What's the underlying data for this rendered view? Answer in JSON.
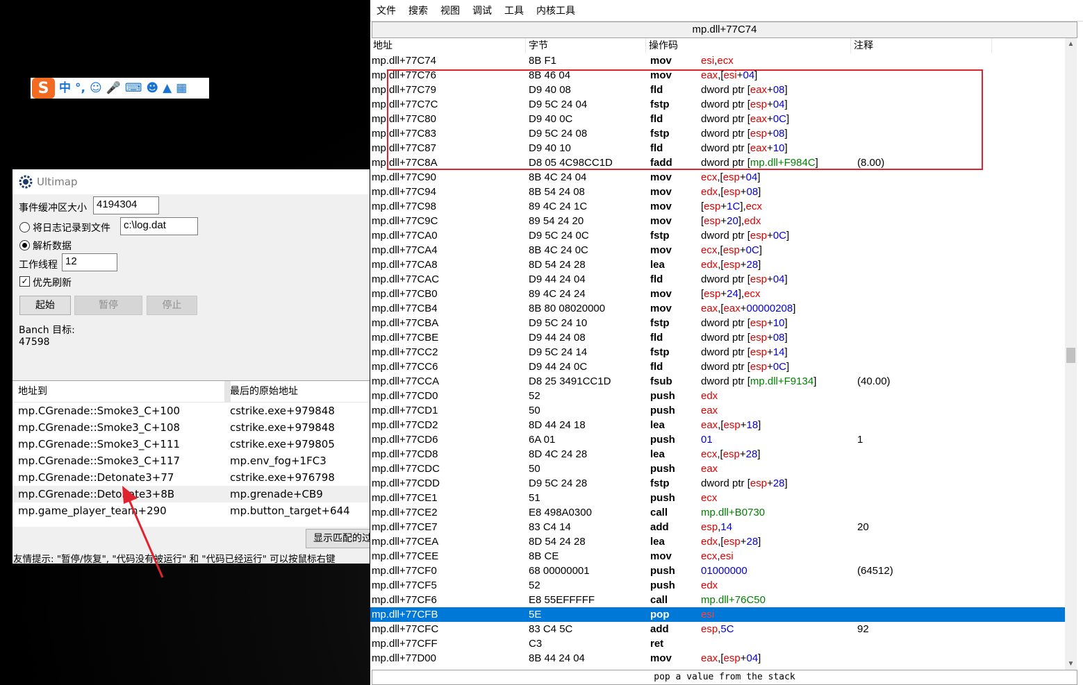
{
  "ime": {
    "logo": "S",
    "items": [
      "中",
      "°,"
    ]
  },
  "ultimap": {
    "title": "Ultimap",
    "buffer_label": "事件缓冲区大小",
    "buffer_value": "4194304",
    "log_label": "将日志记录到文件",
    "log_path": "c:\\log.dat",
    "parse_label": "解析数据",
    "threads_label": "工作线程",
    "threads_value": "12",
    "refresh_label": "优先刷新",
    "btn_start": "起始",
    "btn_pause": "暂停",
    "btn_stop": "停止",
    "branch_label": "Banch 目标:",
    "branch_count": "47598",
    "list": {
      "col1": "地址到",
      "col2": "最后的原始地址",
      "rows": [
        [
          "mp.CGrenade::Smoke3_C+100",
          "cstrike.exe+979848"
        ],
        [
          "mp.CGrenade::Smoke3_C+108",
          "cstrike.exe+979848"
        ],
        [
          "mp.CGrenade::Smoke3_C+111",
          "cstrike.exe+979805"
        ],
        [
          "mp.CGrenade::Smoke3_C+117",
          "mp.env_fog+1FC3"
        ],
        [
          "mp.CGrenade::Detonate3+77",
          "cstrike.exe+976798"
        ],
        [
          "mp.CGrenade::Detonate3+8B",
          "mp.grenade+CB9"
        ],
        [
          "mp.game_player_team+290",
          "mp.button_target+644"
        ]
      ]
    },
    "show_matching_btn": "显示匹配的过",
    "tip": "友情提示: \"暂停/恢复\", \"代码没有被运行\" 和 \"代码已经运行\" 可以按鼠标右键"
  },
  "memview": {
    "menu": [
      "文件",
      "搜索",
      "视图",
      "调试",
      "工具",
      "内核工具"
    ],
    "address": "mp.dll+77C74",
    "headers": [
      "地址",
      "字节",
      "操作码",
      "注释"
    ],
    "status": "pop a value from the stack",
    "rows": [
      {
        "addr": "mp.dll+77C74",
        "bytes": "8B F1",
        "mn": "mov",
        "op": [
          [
            "r",
            "esi"
          ],
          [
            "p",
            ","
          ],
          [
            "r",
            "ecx"
          ]
        ],
        "note": ""
      },
      {
        "addr": "mp.dll+77C76",
        "bytes": "8B 46 04",
        "mn": "mov",
        "op": [
          [
            "r",
            "eax"
          ],
          [
            "p",
            ",["
          ],
          [
            "r",
            "esi"
          ],
          [
            "p",
            "+"
          ],
          [
            "n",
            "04"
          ],
          [
            "p",
            "]"
          ]
        ],
        "note": ""
      },
      {
        "addr": "mp.dll+77C79",
        "bytes": "D9 40 08",
        "mn": "fld",
        "op": [
          [
            "p",
            "dword ptr ["
          ],
          [
            "r",
            "eax"
          ],
          [
            "p",
            "+"
          ],
          [
            "n",
            "08"
          ],
          [
            "p",
            "]"
          ]
        ],
        "note": ""
      },
      {
        "addr": "mp.dll+77C7C",
        "bytes": "D9 5C 24 04",
        "mn": "fstp",
        "op": [
          [
            "p",
            "dword ptr ["
          ],
          [
            "r",
            "esp"
          ],
          [
            "p",
            "+"
          ],
          [
            "n",
            "04"
          ],
          [
            "p",
            "]"
          ]
        ],
        "note": ""
      },
      {
        "addr": "mp.dll+77C80",
        "bytes": "D9 40 0C",
        "mn": "fld",
        "op": [
          [
            "p",
            "dword ptr ["
          ],
          [
            "r",
            "eax"
          ],
          [
            "p",
            "+"
          ],
          [
            "n",
            "0C"
          ],
          [
            "p",
            "]"
          ]
        ],
        "note": ""
      },
      {
        "addr": "mp.dll+77C83",
        "bytes": "D9 5C 24 08",
        "mn": "fstp",
        "op": [
          [
            "p",
            "dword ptr ["
          ],
          [
            "r",
            "esp"
          ],
          [
            "p",
            "+"
          ],
          [
            "n",
            "08"
          ],
          [
            "p",
            "]"
          ]
        ],
        "note": ""
      },
      {
        "addr": "mp.dll+77C87",
        "bytes": "D9 40 10",
        "mn": "fld",
        "op": [
          [
            "p",
            "dword ptr ["
          ],
          [
            "r",
            "eax"
          ],
          [
            "p",
            "+"
          ],
          [
            "n",
            "10"
          ],
          [
            "p",
            "]"
          ]
        ],
        "note": ""
      },
      {
        "addr": "mp.dll+77C8A",
        "bytes": "D8 05 4C98CC1D",
        "mn": "fadd",
        "op": [
          [
            "p",
            "dword ptr ["
          ],
          [
            "s",
            "mp.dll+F984C"
          ],
          [
            "p",
            "]"
          ]
        ],
        "note": "(8.00)"
      },
      {
        "addr": "mp.dll+77C90",
        "bytes": "8B 4C 24 04",
        "mn": "mov",
        "op": [
          [
            "r",
            "ecx"
          ],
          [
            "p",
            ",["
          ],
          [
            "r",
            "esp"
          ],
          [
            "p",
            "+"
          ],
          [
            "n",
            "04"
          ],
          [
            "p",
            "]"
          ]
        ],
        "note": ""
      },
      {
        "addr": "mp.dll+77C94",
        "bytes": "8B 54 24 08",
        "mn": "mov",
        "op": [
          [
            "r",
            "edx"
          ],
          [
            "p",
            ",["
          ],
          [
            "r",
            "esp"
          ],
          [
            "p",
            "+"
          ],
          [
            "n",
            "08"
          ],
          [
            "p",
            "]"
          ]
        ],
        "note": ""
      },
      {
        "addr": "mp.dll+77C98",
        "bytes": "89 4C 24 1C",
        "mn": "mov",
        "op": [
          [
            "p",
            "["
          ],
          [
            "r",
            "esp"
          ],
          [
            "p",
            "+"
          ],
          [
            "n",
            "1C"
          ],
          [
            "p",
            "],"
          ],
          [
            "r",
            "ecx"
          ]
        ],
        "note": ""
      },
      {
        "addr": "mp.dll+77C9C",
        "bytes": "89 54 24 20",
        "mn": "mov",
        "op": [
          [
            "p",
            "["
          ],
          [
            "r",
            "esp"
          ],
          [
            "p",
            "+"
          ],
          [
            "n",
            "20"
          ],
          [
            "p",
            "],"
          ],
          [
            "r",
            "edx"
          ]
        ],
        "note": ""
      },
      {
        "addr": "mp.dll+77CA0",
        "bytes": "D9 5C 24 0C",
        "mn": "fstp",
        "op": [
          [
            "p",
            "dword ptr ["
          ],
          [
            "r",
            "esp"
          ],
          [
            "p",
            "+"
          ],
          [
            "n",
            "0C"
          ],
          [
            "p",
            "]"
          ]
        ],
        "note": ""
      },
      {
        "addr": "mp.dll+77CA4",
        "bytes": "8B 4C 24 0C",
        "mn": "mov",
        "op": [
          [
            "r",
            "ecx"
          ],
          [
            "p",
            ",["
          ],
          [
            "r",
            "esp"
          ],
          [
            "p",
            "+"
          ],
          [
            "n",
            "0C"
          ],
          [
            "p",
            "]"
          ]
        ],
        "note": ""
      },
      {
        "addr": "mp.dll+77CA8",
        "bytes": "8D 54 24 28",
        "mn": "lea",
        "op": [
          [
            "r",
            "edx"
          ],
          [
            "p",
            ",["
          ],
          [
            "r",
            "esp"
          ],
          [
            "p",
            "+"
          ],
          [
            "n",
            "28"
          ],
          [
            "p",
            "]"
          ]
        ],
        "note": ""
      },
      {
        "addr": "mp.dll+77CAC",
        "bytes": "D9 44 24 04",
        "mn": "fld",
        "op": [
          [
            "p",
            "dword ptr ["
          ],
          [
            "r",
            "esp"
          ],
          [
            "p",
            "+"
          ],
          [
            "n",
            "04"
          ],
          [
            "p",
            "]"
          ]
        ],
        "note": ""
      },
      {
        "addr": "mp.dll+77CB0",
        "bytes": "89 4C 24 24",
        "mn": "mov",
        "op": [
          [
            "p",
            "["
          ],
          [
            "r",
            "esp"
          ],
          [
            "p",
            "+"
          ],
          [
            "n",
            "24"
          ],
          [
            "p",
            "],"
          ],
          [
            "r",
            "ecx"
          ]
        ],
        "note": ""
      },
      {
        "addr": "mp.dll+77CB4",
        "bytes": "8B 80 08020000",
        "mn": "mov",
        "op": [
          [
            "r",
            "eax"
          ],
          [
            "p",
            ",["
          ],
          [
            "r",
            "eax"
          ],
          [
            "p",
            "+"
          ],
          [
            "n",
            "00000208"
          ],
          [
            "p",
            "]"
          ]
        ],
        "note": ""
      },
      {
        "addr": "mp.dll+77CBA",
        "bytes": "D9 5C 24 10",
        "mn": "fstp",
        "op": [
          [
            "p",
            "dword ptr ["
          ],
          [
            "r",
            "esp"
          ],
          [
            "p",
            "+"
          ],
          [
            "n",
            "10"
          ],
          [
            "p",
            "]"
          ]
        ],
        "note": ""
      },
      {
        "addr": "mp.dll+77CBE",
        "bytes": "D9 44 24 08",
        "mn": "fld",
        "op": [
          [
            "p",
            "dword ptr ["
          ],
          [
            "r",
            "esp"
          ],
          [
            "p",
            "+"
          ],
          [
            "n",
            "08"
          ],
          [
            "p",
            "]"
          ]
        ],
        "note": ""
      },
      {
        "addr": "mp.dll+77CC2",
        "bytes": "D9 5C 24 14",
        "mn": "fstp",
        "op": [
          [
            "p",
            "dword ptr ["
          ],
          [
            "r",
            "esp"
          ],
          [
            "p",
            "+"
          ],
          [
            "n",
            "14"
          ],
          [
            "p",
            "]"
          ]
        ],
        "note": ""
      },
      {
        "addr": "mp.dll+77CC6",
        "bytes": "D9 44 24 0C",
        "mn": "fld",
        "op": [
          [
            "p",
            "dword ptr ["
          ],
          [
            "r",
            "esp"
          ],
          [
            "p",
            "+"
          ],
          [
            "n",
            "0C"
          ],
          [
            "p",
            "]"
          ]
        ],
        "note": ""
      },
      {
        "addr": "mp.dll+77CCA",
        "bytes": "D8 25 3491CC1D",
        "mn": "fsub",
        "op": [
          [
            "p",
            "dword ptr ["
          ],
          [
            "s",
            "mp.dll+F9134"
          ],
          [
            "p",
            "]"
          ]
        ],
        "note": "(40.00)"
      },
      {
        "addr": "mp.dll+77CD0",
        "bytes": "52",
        "mn": "push",
        "op": [
          [
            "r",
            "edx"
          ]
        ],
        "note": ""
      },
      {
        "addr": "mp.dll+77CD1",
        "bytes": "50",
        "mn": "push",
        "op": [
          [
            "r",
            "eax"
          ]
        ],
        "note": ""
      },
      {
        "addr": "mp.dll+77CD2",
        "bytes": "8D 44 24 18",
        "mn": "lea",
        "op": [
          [
            "r",
            "eax"
          ],
          [
            "p",
            ",["
          ],
          [
            "r",
            "esp"
          ],
          [
            "p",
            "+"
          ],
          [
            "n",
            "18"
          ],
          [
            "p",
            "]"
          ]
        ],
        "note": ""
      },
      {
        "addr": "mp.dll+77CD6",
        "bytes": "6A 01",
        "mn": "push",
        "op": [
          [
            "n",
            "01"
          ]
        ],
        "note": "1"
      },
      {
        "addr": "mp.dll+77CD8",
        "bytes": "8D 4C 24 28",
        "mn": "lea",
        "op": [
          [
            "r",
            "ecx"
          ],
          [
            "p",
            ",["
          ],
          [
            "r",
            "esp"
          ],
          [
            "p",
            "+"
          ],
          [
            "n",
            "28"
          ],
          [
            "p",
            "]"
          ]
        ],
        "note": ""
      },
      {
        "addr": "mp.dll+77CDC",
        "bytes": "50",
        "mn": "push",
        "op": [
          [
            "r",
            "eax"
          ]
        ],
        "note": ""
      },
      {
        "addr": "mp.dll+77CDD",
        "bytes": "D9 5C 24 28",
        "mn": "fstp",
        "op": [
          [
            "p",
            "dword ptr ["
          ],
          [
            "r",
            "esp"
          ],
          [
            "p",
            "+"
          ],
          [
            "n",
            "28"
          ],
          [
            "p",
            "]"
          ]
        ],
        "note": ""
      },
      {
        "addr": "mp.dll+77CE1",
        "bytes": "51",
        "mn": "push",
        "op": [
          [
            "r",
            "ecx"
          ]
        ],
        "note": ""
      },
      {
        "addr": "mp.dll+77CE2",
        "bytes": "E8 498A0300",
        "mn": "call",
        "op": [
          [
            "s",
            "mp.dll+B0730"
          ]
        ],
        "note": ""
      },
      {
        "addr": "mp.dll+77CE7",
        "bytes": "83 C4 14",
        "mn": "add",
        "op": [
          [
            "r",
            "esp"
          ],
          [
            "p",
            ","
          ],
          [
            "n",
            "14"
          ]
        ],
        "note": "20"
      },
      {
        "addr": "mp.dll+77CEA",
        "bytes": "8D 54 24 28",
        "mn": "lea",
        "op": [
          [
            "r",
            "edx"
          ],
          [
            "p",
            ",["
          ],
          [
            "r",
            "esp"
          ],
          [
            "p",
            "+"
          ],
          [
            "n",
            "28"
          ],
          [
            "p",
            "]"
          ]
        ],
        "note": ""
      },
      {
        "addr": "mp.dll+77CEE",
        "bytes": "8B CE",
        "mn": "mov",
        "op": [
          [
            "r",
            "ecx"
          ],
          [
            "p",
            ","
          ],
          [
            "r",
            "esi"
          ]
        ],
        "note": ""
      },
      {
        "addr": "mp.dll+77CF0",
        "bytes": "68 00000001",
        "mn": "push",
        "op": [
          [
            "n",
            "01000000"
          ]
        ],
        "note": "(64512)"
      },
      {
        "addr": "mp.dll+77CF5",
        "bytes": "52",
        "mn": "push",
        "op": [
          [
            "r",
            "edx"
          ]
        ],
        "note": ""
      },
      {
        "addr": "mp.dll+77CF6",
        "bytes": "E8 55EFFFFF",
        "mn": "call",
        "op": [
          [
            "s",
            "mp.dll+76C50"
          ]
        ],
        "note": ""
      },
      {
        "addr": "mp.dll+77CFB",
        "bytes": "5E",
        "mn": "pop",
        "op": [
          [
            "r",
            "esi"
          ]
        ],
        "note": "",
        "selected": true
      },
      {
        "addr": "mp.dll+77CFC",
        "bytes": "83 C4 5C",
        "mn": "add",
        "op": [
          [
            "r",
            "esp"
          ],
          [
            "p",
            ","
          ],
          [
            "n",
            "5C"
          ]
        ],
        "note": "92"
      },
      {
        "addr": "mp.dll+77CFF",
        "bytes": "C3",
        "mn": "ret",
        "op": [],
        "note": ""
      },
      {
        "addr": "mp.dll+77D00",
        "bytes": "8B 44 24 04",
        "mn": "mov",
        "op": [
          [
            "r",
            "eax"
          ],
          [
            "p",
            ",["
          ],
          [
            "r",
            "esp"
          ],
          [
            "p",
            "+"
          ],
          [
            "n",
            "04"
          ],
          [
            "p",
            "]"
          ]
        ],
        "note": ""
      }
    ]
  },
  "colors": {
    "register": "#e00000",
    "number": "#0000e0",
    "symbol": "#008000",
    "selection": "#0078d7",
    "highlight_box": "#e0242f",
    "arrow": "#e0242f"
  }
}
